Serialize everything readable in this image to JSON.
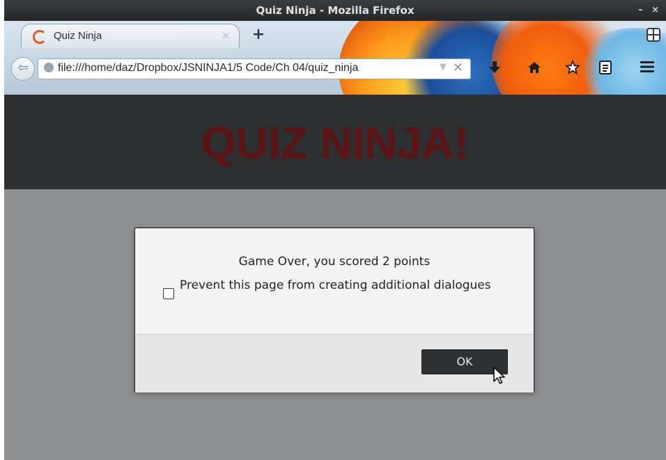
{
  "window": {
    "title": "Quiz Ninja - Mozilla Firefox",
    "controls": "– ×"
  },
  "tab": {
    "title": "Quiz Ninja",
    "close": "×",
    "new_tab": "+"
  },
  "navbar": {
    "url": "file:///home/daz/Dropbox/JSNINJA1/5 Code/Ch 04/quiz_ninja",
    "dropdown": "▼",
    "clear": "✕",
    "icons": [
      "back-icon",
      "globe-icon",
      "download-icon",
      "home-icon",
      "bookmark-star-icon",
      "reader-icon",
      "menu-icon",
      "tabs-grid-icon"
    ]
  },
  "page": {
    "title": "QUIZ NINJA!"
  },
  "dialog": {
    "message": "Game Over, you scored 2 points",
    "checkbox_label": "Prevent this page from creating additional dialogues",
    "ok_label": "OK"
  }
}
